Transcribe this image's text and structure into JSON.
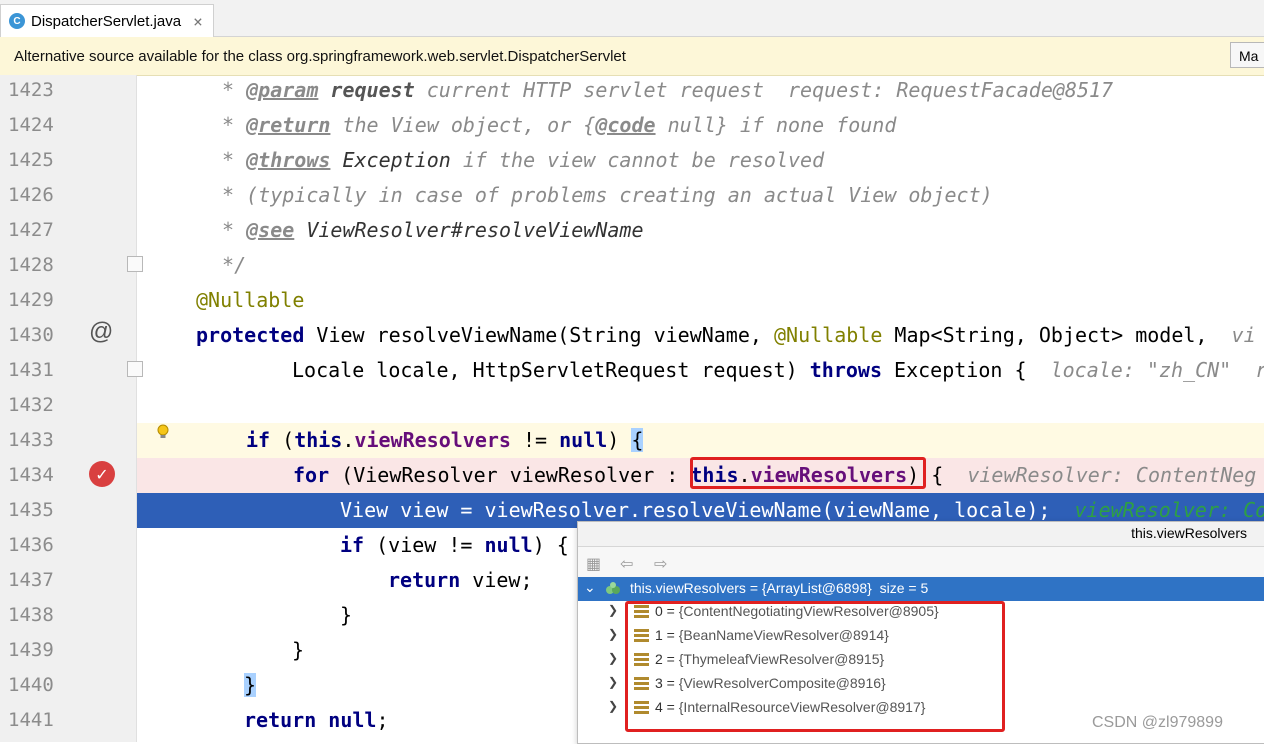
{
  "tab": {
    "icon_letter": "C",
    "title": "DispatcherServlet.java",
    "close": "×"
  },
  "notice": {
    "message": "Alternative source available for the class org.springframework.web.servlet.DispatcherServlet",
    "button": "Ma"
  },
  "line_numbers": [
    "1423",
    "1424",
    "1425",
    "1426",
    "1427",
    "1428",
    "1429",
    "1430",
    "1431",
    "1432",
    "1433",
    "1434",
    "1435",
    "1436",
    "1437",
    "1438",
    "1439",
    "1440",
    "1441"
  ],
  "code": {
    "l1423": {
      "star": " * ",
      "tag": "@param",
      "name": " request",
      "rest": " current HTTP servlet request",
      "hint": "  request: RequestFacade@8517"
    },
    "l1424": {
      "star": " * ",
      "tag": "@return",
      "rest1": " the View object, or {",
      "tag2": "@code",
      "rest2": " null} if none found"
    },
    "l1425": {
      "star": " * ",
      "tag": "@throws",
      "name": " Exception",
      "rest": " if the view cannot be resolved"
    },
    "l1426": {
      "text": " * (typically in case of problems creating an actual View object)"
    },
    "l1427": {
      "star": " * ",
      "tag": "@see",
      "name": " ViewResolver#resolveViewName"
    },
    "l1428": {
      "text": " */"
    },
    "l1429": {
      "ann": "@Nullable"
    },
    "l1430": {
      "kw": "protected",
      "t1": " View resolveViewName(String viewName, ",
      "ann": "@Nullable",
      "t2": " Map<String, Object> model,",
      "hint": "  vi"
    },
    "l1431": {
      "t1": "Locale locale, HttpServletRequest request) ",
      "kw": "throws",
      "t2": " Exception {",
      "hint": "  locale: \"zh_CN\"  r"
    },
    "l1433": {
      "kw": "if",
      "t1": " (",
      "kw2": "this",
      "t2": ".",
      "field": "viewResolvers",
      "t3": " != ",
      "kw3": "null",
      "t4": ") ",
      "brace": "{"
    },
    "l1434": {
      "kw": "for",
      "t1": " (ViewResolver viewResolver : ",
      "kw2": "this",
      "t2": ".",
      "field": "viewResolvers",
      "t3": ") {",
      "hint": "  viewResolver: ContentNeg"
    },
    "l1435": {
      "t1": "View view = viewResolver.resolveViewName(viewName, locale);",
      "hint": "  viewResolver: Co"
    },
    "l1436": {
      "kw": "if",
      "t1": " (view != ",
      "kw2": "null",
      "t2": ") {"
    },
    "l1437": {
      "kw": "return",
      "t1": " view;"
    },
    "l1438": {
      "t1": "}"
    },
    "l1439": {
      "t1": "}"
    },
    "l1440": {
      "brace": "}"
    },
    "l1441": {
      "kw": "return",
      "t1": " ",
      "kw2": "null",
      "t2": ";"
    }
  },
  "popup": {
    "title": "this.viewResolvers",
    "root": "this.viewResolvers = {ArrayList@6898}  size = 5",
    "items": [
      {
        "idx": "0 = ",
        "val": "{ContentNegotiatingViewResolver@8905}"
      },
      {
        "idx": "1 = ",
        "val": "{BeanNameViewResolver@8914}"
      },
      {
        "idx": "2 = ",
        "val": "{ThymeleafViewResolver@8915}"
      },
      {
        "idx": "3 = ",
        "val": "{ViewResolverComposite@8916}"
      },
      {
        "idx": "4 = ",
        "val": "{InternalResourceViewResolver@8917}"
      }
    ]
  },
  "watermark": "CSDN @zl979899",
  "colors": {
    "selection": "#2e5fb7",
    "breakpoint_line": "#fae6e6",
    "current_line": "#fffae3",
    "annotation_box": "#e02020"
  }
}
